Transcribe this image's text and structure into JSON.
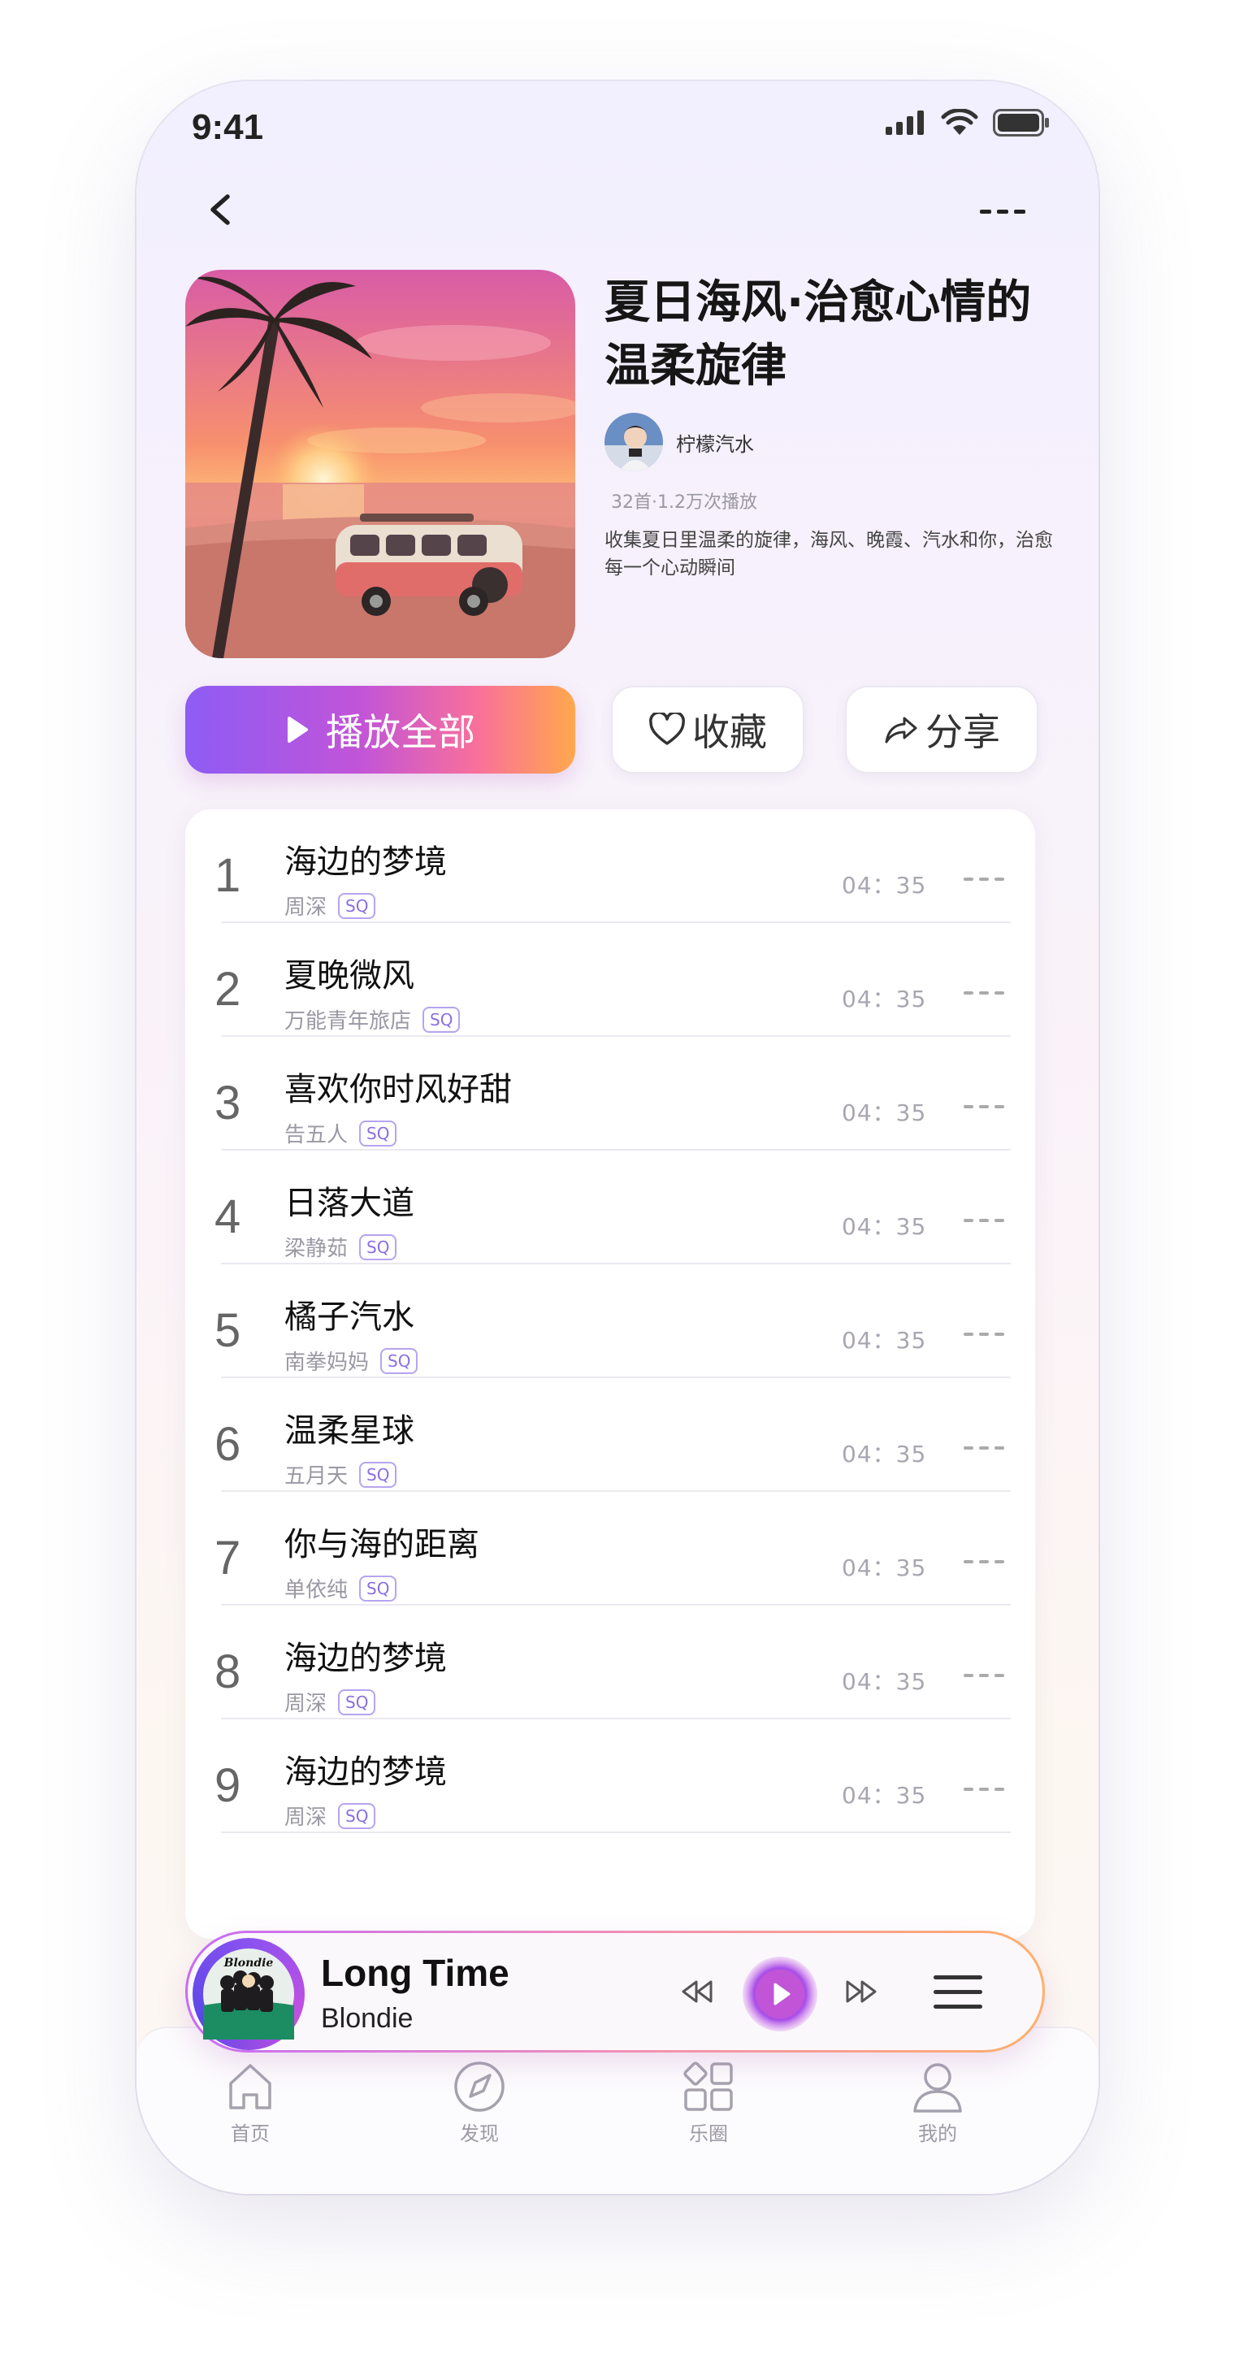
{
  "status": {
    "time": "9:41"
  },
  "playlist": {
    "title": "夏日海风·治愈心情的温柔旋律",
    "creator": "柠檬汽水",
    "stats": "32首·1.2万次播放",
    "description": "收集夏日里温柔的旋律，海风、晚霞、汽水和你，治愈每一个心动瞬间"
  },
  "actions": {
    "play_all": "播放全部",
    "favorite": "收藏",
    "share": "分享"
  },
  "tracks": [
    {
      "index": "1",
      "title": "海边的梦境",
      "artist": "周深",
      "badge": "SQ",
      "duration": "04：35"
    },
    {
      "index": "2",
      "title": "夏晚微风",
      "artist": "万能青年旅店",
      "badge": "SQ",
      "duration": "04：35"
    },
    {
      "index": "3",
      "title": "喜欢你时风好甜",
      "artist": "告五人",
      "badge": "SQ",
      "duration": "04：35"
    },
    {
      "index": "4",
      "title": "日落大道",
      "artist": "梁静茹",
      "badge": "SQ",
      "duration": "04：35"
    },
    {
      "index": "5",
      "title": "橘子汽水",
      "artist": "南拳妈妈",
      "badge": "SQ",
      "duration": "04：35"
    },
    {
      "index": "6",
      "title": "温柔星球",
      "artist": "五月天",
      "badge": "SQ",
      "duration": "04：35"
    },
    {
      "index": "7",
      "title": "你与海的距离",
      "artist": "单依纯",
      "badge": "SQ",
      "duration": "04：35"
    },
    {
      "index": "8",
      "title": "海边的梦境",
      "artist": "周深",
      "badge": "SQ",
      "duration": "04：35"
    },
    {
      "index": "9",
      "title": "海边的梦境",
      "artist": "周深",
      "badge": "SQ",
      "duration": "04：35"
    }
  ],
  "now_playing": {
    "title": "Long Time",
    "artist": "Blondie",
    "art_text": "Blondie"
  },
  "tabs": [
    {
      "label": "首页"
    },
    {
      "label": "发现"
    },
    {
      "label": "乐圈"
    },
    {
      "label": "我的"
    }
  ],
  "colors": {
    "accent_purple": "#8d5cf5",
    "accent_orange": "#ffa84c",
    "sq_badge": "#8a6fe0"
  }
}
